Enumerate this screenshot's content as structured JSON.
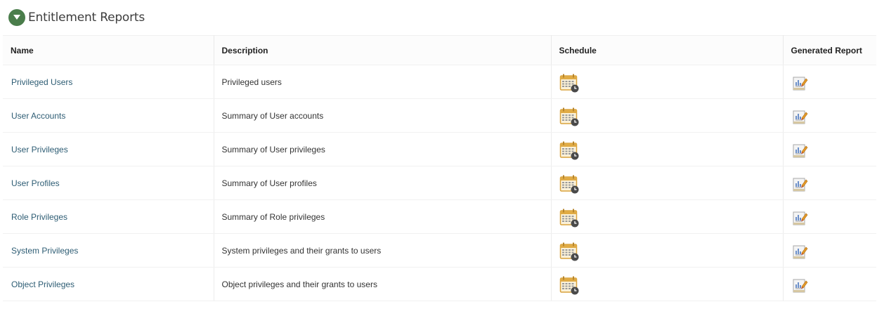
{
  "section": {
    "title": "Entitlement Reports",
    "toggle_icon": "triangle-down-icon",
    "toggle_color": "#4a7d4b"
  },
  "table": {
    "columns": [
      "Name",
      "Description",
      "Schedule",
      "Generated Report"
    ],
    "schedule_icon": "calendar-clock-icon",
    "report_icon": "report-chart-icon",
    "link_color": "#2e5d74",
    "rows": [
      {
        "name": "Privileged Users",
        "description": "Privileged users"
      },
      {
        "name": "User Accounts",
        "description": "Summary of User accounts"
      },
      {
        "name": "User Privileges",
        "description": "Summary of User privileges"
      },
      {
        "name": "User Profiles",
        "description": "Summary of User profiles"
      },
      {
        "name": "Role Privileges",
        "description": "Summary of Role privileges"
      },
      {
        "name": "System Privileges",
        "description": "System privileges and their grants to users"
      },
      {
        "name": "Object Privileges",
        "description": "Object privileges and their grants to users"
      }
    ]
  }
}
